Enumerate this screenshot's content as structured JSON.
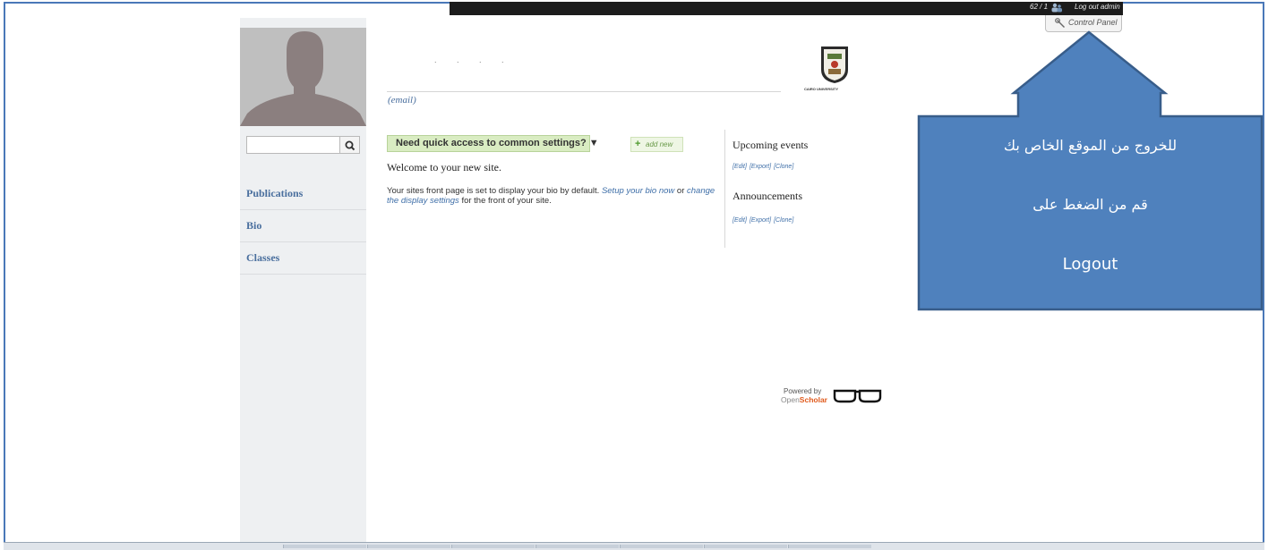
{
  "sidebar": {
    "search": {
      "placeholder": ""
    },
    "items": [
      {
        "label": "Publications"
      },
      {
        "label": "Bio"
      },
      {
        "label": "Classes"
      }
    ]
  },
  "topbar": {
    "counter": "62 / 1",
    "logout_label": "Log out admin",
    "control_panel_label": "Control Panel"
  },
  "header": {
    "site_name": ". . . .",
    "email": "(email)",
    "logo_caption": "CAIRO UNIVERSITY"
  },
  "main": {
    "settings_label": "Need quick access to common settings? ▼",
    "add_new_label": "add new",
    "welcome": "Welcome to your new site.",
    "intro_text_1": "Your sites front page is set to display your bio by default.",
    "intro_link_1": "Setup your bio now",
    "intro_text_2": "or",
    "intro_link_2": "change the display settings",
    "intro_text_3": "for the front of your site."
  },
  "right": {
    "events_title": "Upcoming events",
    "announcements_title": "Announcements",
    "links": {
      "edit": "[Edit]",
      "export": "[Export]",
      "clone": "[Clone]"
    }
  },
  "footer": {
    "powered_by": "Powered by",
    "brand_open": "Open",
    "brand_scholar": "Scholar"
  },
  "callout": {
    "line1": "للخروج من الموقع الخاص بك",
    "line2": "قم من الضغط على",
    "line3": "Logout",
    "fill_color": "#4f81bd",
    "border_color": "#385d8a"
  }
}
